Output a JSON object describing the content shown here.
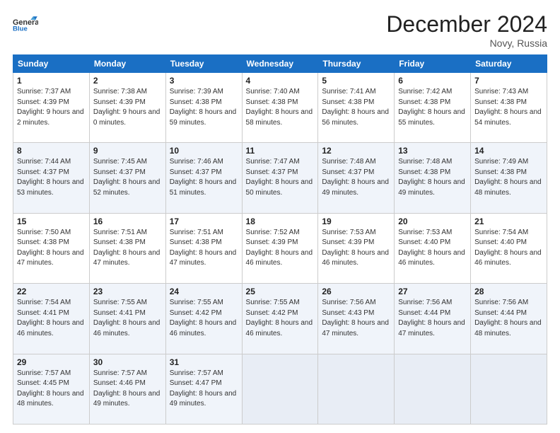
{
  "header": {
    "logo_line1": "General",
    "logo_line2": "Blue",
    "title": "December 2024",
    "subtitle": "Novy, Russia"
  },
  "days_of_week": [
    "Sunday",
    "Monday",
    "Tuesday",
    "Wednesday",
    "Thursday",
    "Friday",
    "Saturday"
  ],
  "weeks": [
    [
      {
        "day": "1",
        "sunrise": "Sunrise: 7:37 AM",
        "sunset": "Sunset: 4:39 PM",
        "daylight": "Daylight: 9 hours and 2 minutes."
      },
      {
        "day": "2",
        "sunrise": "Sunrise: 7:38 AM",
        "sunset": "Sunset: 4:39 PM",
        "daylight": "Daylight: 9 hours and 0 minutes."
      },
      {
        "day": "3",
        "sunrise": "Sunrise: 7:39 AM",
        "sunset": "Sunset: 4:38 PM",
        "daylight": "Daylight: 8 hours and 59 minutes."
      },
      {
        "day": "4",
        "sunrise": "Sunrise: 7:40 AM",
        "sunset": "Sunset: 4:38 PM",
        "daylight": "Daylight: 8 hours and 58 minutes."
      },
      {
        "day": "5",
        "sunrise": "Sunrise: 7:41 AM",
        "sunset": "Sunset: 4:38 PM",
        "daylight": "Daylight: 8 hours and 56 minutes."
      },
      {
        "day": "6",
        "sunrise": "Sunrise: 7:42 AM",
        "sunset": "Sunset: 4:38 PM",
        "daylight": "Daylight: 8 hours and 55 minutes."
      },
      {
        "day": "7",
        "sunrise": "Sunrise: 7:43 AM",
        "sunset": "Sunset: 4:38 PM",
        "daylight": "Daylight: 8 hours and 54 minutes."
      }
    ],
    [
      {
        "day": "8",
        "sunrise": "Sunrise: 7:44 AM",
        "sunset": "Sunset: 4:37 PM",
        "daylight": "Daylight: 8 hours and 53 minutes."
      },
      {
        "day": "9",
        "sunrise": "Sunrise: 7:45 AM",
        "sunset": "Sunset: 4:37 PM",
        "daylight": "Daylight: 8 hours and 52 minutes."
      },
      {
        "day": "10",
        "sunrise": "Sunrise: 7:46 AM",
        "sunset": "Sunset: 4:37 PM",
        "daylight": "Daylight: 8 hours and 51 minutes."
      },
      {
        "day": "11",
        "sunrise": "Sunrise: 7:47 AM",
        "sunset": "Sunset: 4:37 PM",
        "daylight": "Daylight: 8 hours and 50 minutes."
      },
      {
        "day": "12",
        "sunrise": "Sunrise: 7:48 AM",
        "sunset": "Sunset: 4:37 PM",
        "daylight": "Daylight: 8 hours and 49 minutes."
      },
      {
        "day": "13",
        "sunrise": "Sunrise: 7:48 AM",
        "sunset": "Sunset: 4:38 PM",
        "daylight": "Daylight: 8 hours and 49 minutes."
      },
      {
        "day": "14",
        "sunrise": "Sunrise: 7:49 AM",
        "sunset": "Sunset: 4:38 PM",
        "daylight": "Daylight: 8 hours and 48 minutes."
      }
    ],
    [
      {
        "day": "15",
        "sunrise": "Sunrise: 7:50 AM",
        "sunset": "Sunset: 4:38 PM",
        "daylight": "Daylight: 8 hours and 47 minutes."
      },
      {
        "day": "16",
        "sunrise": "Sunrise: 7:51 AM",
        "sunset": "Sunset: 4:38 PM",
        "daylight": "Daylight: 8 hours and 47 minutes."
      },
      {
        "day": "17",
        "sunrise": "Sunrise: 7:51 AM",
        "sunset": "Sunset: 4:38 PM",
        "daylight": "Daylight: 8 hours and 47 minutes."
      },
      {
        "day": "18",
        "sunrise": "Sunrise: 7:52 AM",
        "sunset": "Sunset: 4:39 PM",
        "daylight": "Daylight: 8 hours and 46 minutes."
      },
      {
        "day": "19",
        "sunrise": "Sunrise: 7:53 AM",
        "sunset": "Sunset: 4:39 PM",
        "daylight": "Daylight: 8 hours and 46 minutes."
      },
      {
        "day": "20",
        "sunrise": "Sunrise: 7:53 AM",
        "sunset": "Sunset: 4:40 PM",
        "daylight": "Daylight: 8 hours and 46 minutes."
      },
      {
        "day": "21",
        "sunrise": "Sunrise: 7:54 AM",
        "sunset": "Sunset: 4:40 PM",
        "daylight": "Daylight: 8 hours and 46 minutes."
      }
    ],
    [
      {
        "day": "22",
        "sunrise": "Sunrise: 7:54 AM",
        "sunset": "Sunset: 4:41 PM",
        "daylight": "Daylight: 8 hours and 46 minutes."
      },
      {
        "day": "23",
        "sunrise": "Sunrise: 7:55 AM",
        "sunset": "Sunset: 4:41 PM",
        "daylight": "Daylight: 8 hours and 46 minutes."
      },
      {
        "day": "24",
        "sunrise": "Sunrise: 7:55 AM",
        "sunset": "Sunset: 4:42 PM",
        "daylight": "Daylight: 8 hours and 46 minutes."
      },
      {
        "day": "25",
        "sunrise": "Sunrise: 7:55 AM",
        "sunset": "Sunset: 4:42 PM",
        "daylight": "Daylight: 8 hours and 46 minutes."
      },
      {
        "day": "26",
        "sunrise": "Sunrise: 7:56 AM",
        "sunset": "Sunset: 4:43 PM",
        "daylight": "Daylight: 8 hours and 47 minutes."
      },
      {
        "day": "27",
        "sunrise": "Sunrise: 7:56 AM",
        "sunset": "Sunset: 4:44 PM",
        "daylight": "Daylight: 8 hours and 47 minutes."
      },
      {
        "day": "28",
        "sunrise": "Sunrise: 7:56 AM",
        "sunset": "Sunset: 4:44 PM",
        "daylight": "Daylight: 8 hours and 48 minutes."
      }
    ],
    [
      {
        "day": "29",
        "sunrise": "Sunrise: 7:57 AM",
        "sunset": "Sunset: 4:45 PM",
        "daylight": "Daylight: 8 hours and 48 minutes."
      },
      {
        "day": "30",
        "sunrise": "Sunrise: 7:57 AM",
        "sunset": "Sunset: 4:46 PM",
        "daylight": "Daylight: 8 hours and 49 minutes."
      },
      {
        "day": "31",
        "sunrise": "Sunrise: 7:57 AM",
        "sunset": "Sunset: 4:47 PM",
        "daylight": "Daylight: 8 hours and 49 minutes."
      },
      null,
      null,
      null,
      null
    ]
  ]
}
